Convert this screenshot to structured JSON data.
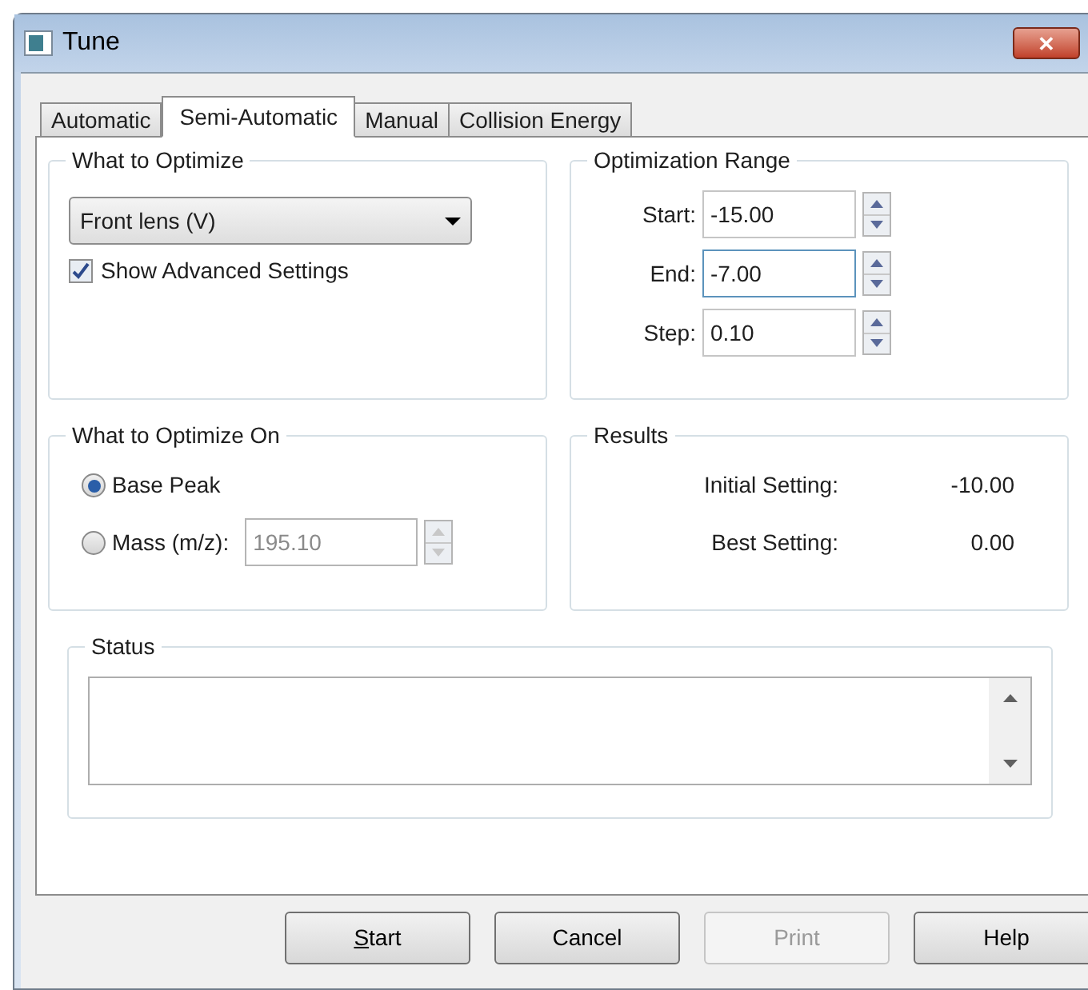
{
  "window": {
    "title": "Tune",
    "close": "✕"
  },
  "tabs": [
    {
      "label": "Automatic",
      "selected": false
    },
    {
      "label": "Semi-Automatic",
      "selected": true
    },
    {
      "label": "Manual",
      "selected": false
    },
    {
      "label": "Collision Energy",
      "selected": false
    }
  ],
  "what_to_optimize": {
    "title": "What to Optimize",
    "dropdown": "Front lens (V)",
    "checkbox": {
      "label": "Show Advanced Settings",
      "checked": true
    }
  },
  "optimization_range": {
    "title": "Optimization Range",
    "fields": [
      {
        "label": "Start:",
        "value": "-15.00",
        "focused": false
      },
      {
        "label": "End:",
        "value": "-7.00",
        "focused": true
      },
      {
        "label": "Step:",
        "value": "0.10",
        "focused": false
      }
    ]
  },
  "what_to_optimize_on": {
    "title": "What to Optimize On",
    "options": [
      {
        "label": "Base Peak",
        "selected": true
      },
      {
        "label": "Mass (m/z):",
        "selected": false,
        "value": "195.10"
      }
    ]
  },
  "results": {
    "title": "Results",
    "rows": [
      {
        "label": "Initial Setting:",
        "value": "-10.00"
      },
      {
        "label": "Best Setting:",
        "value": "0.00"
      }
    ]
  },
  "status": {
    "title": "Status"
  },
  "buttons": [
    {
      "label": "Start",
      "disabled": false,
      "access_key": true
    },
    {
      "label": "Cancel",
      "disabled": false,
      "access_key": false
    },
    {
      "label": "Print",
      "disabled": true,
      "access_key": false
    },
    {
      "label": "Help",
      "disabled": false,
      "access_key": false
    }
  ]
}
